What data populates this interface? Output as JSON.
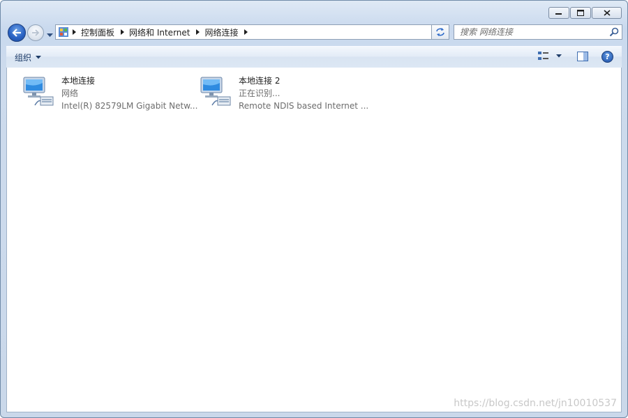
{
  "window": {
    "caption": {
      "minimize": "minimize",
      "maximize": "maximize",
      "close": "close"
    }
  },
  "nav": {
    "breadcrumbs": [
      "控制面板",
      "网络和 Internet",
      "网络连接"
    ]
  },
  "search": {
    "placeholder": "搜索 网络连接"
  },
  "toolbar": {
    "organize_label": "组织"
  },
  "connections": [
    {
      "name": "本地连接",
      "status": "网络",
      "device": "Intel(R) 82579LM Gigabit Netw..."
    },
    {
      "name": "本地连接 2",
      "status": "正在识别...",
      "device": "Remote NDIS based Internet ..."
    }
  ],
  "watermark": "https://blog.csdn.net/jn10010537",
  "colors": {
    "accent": "#2a63c4",
    "chrome": "#cad8ea",
    "text_gray": "#6d6d6d"
  }
}
